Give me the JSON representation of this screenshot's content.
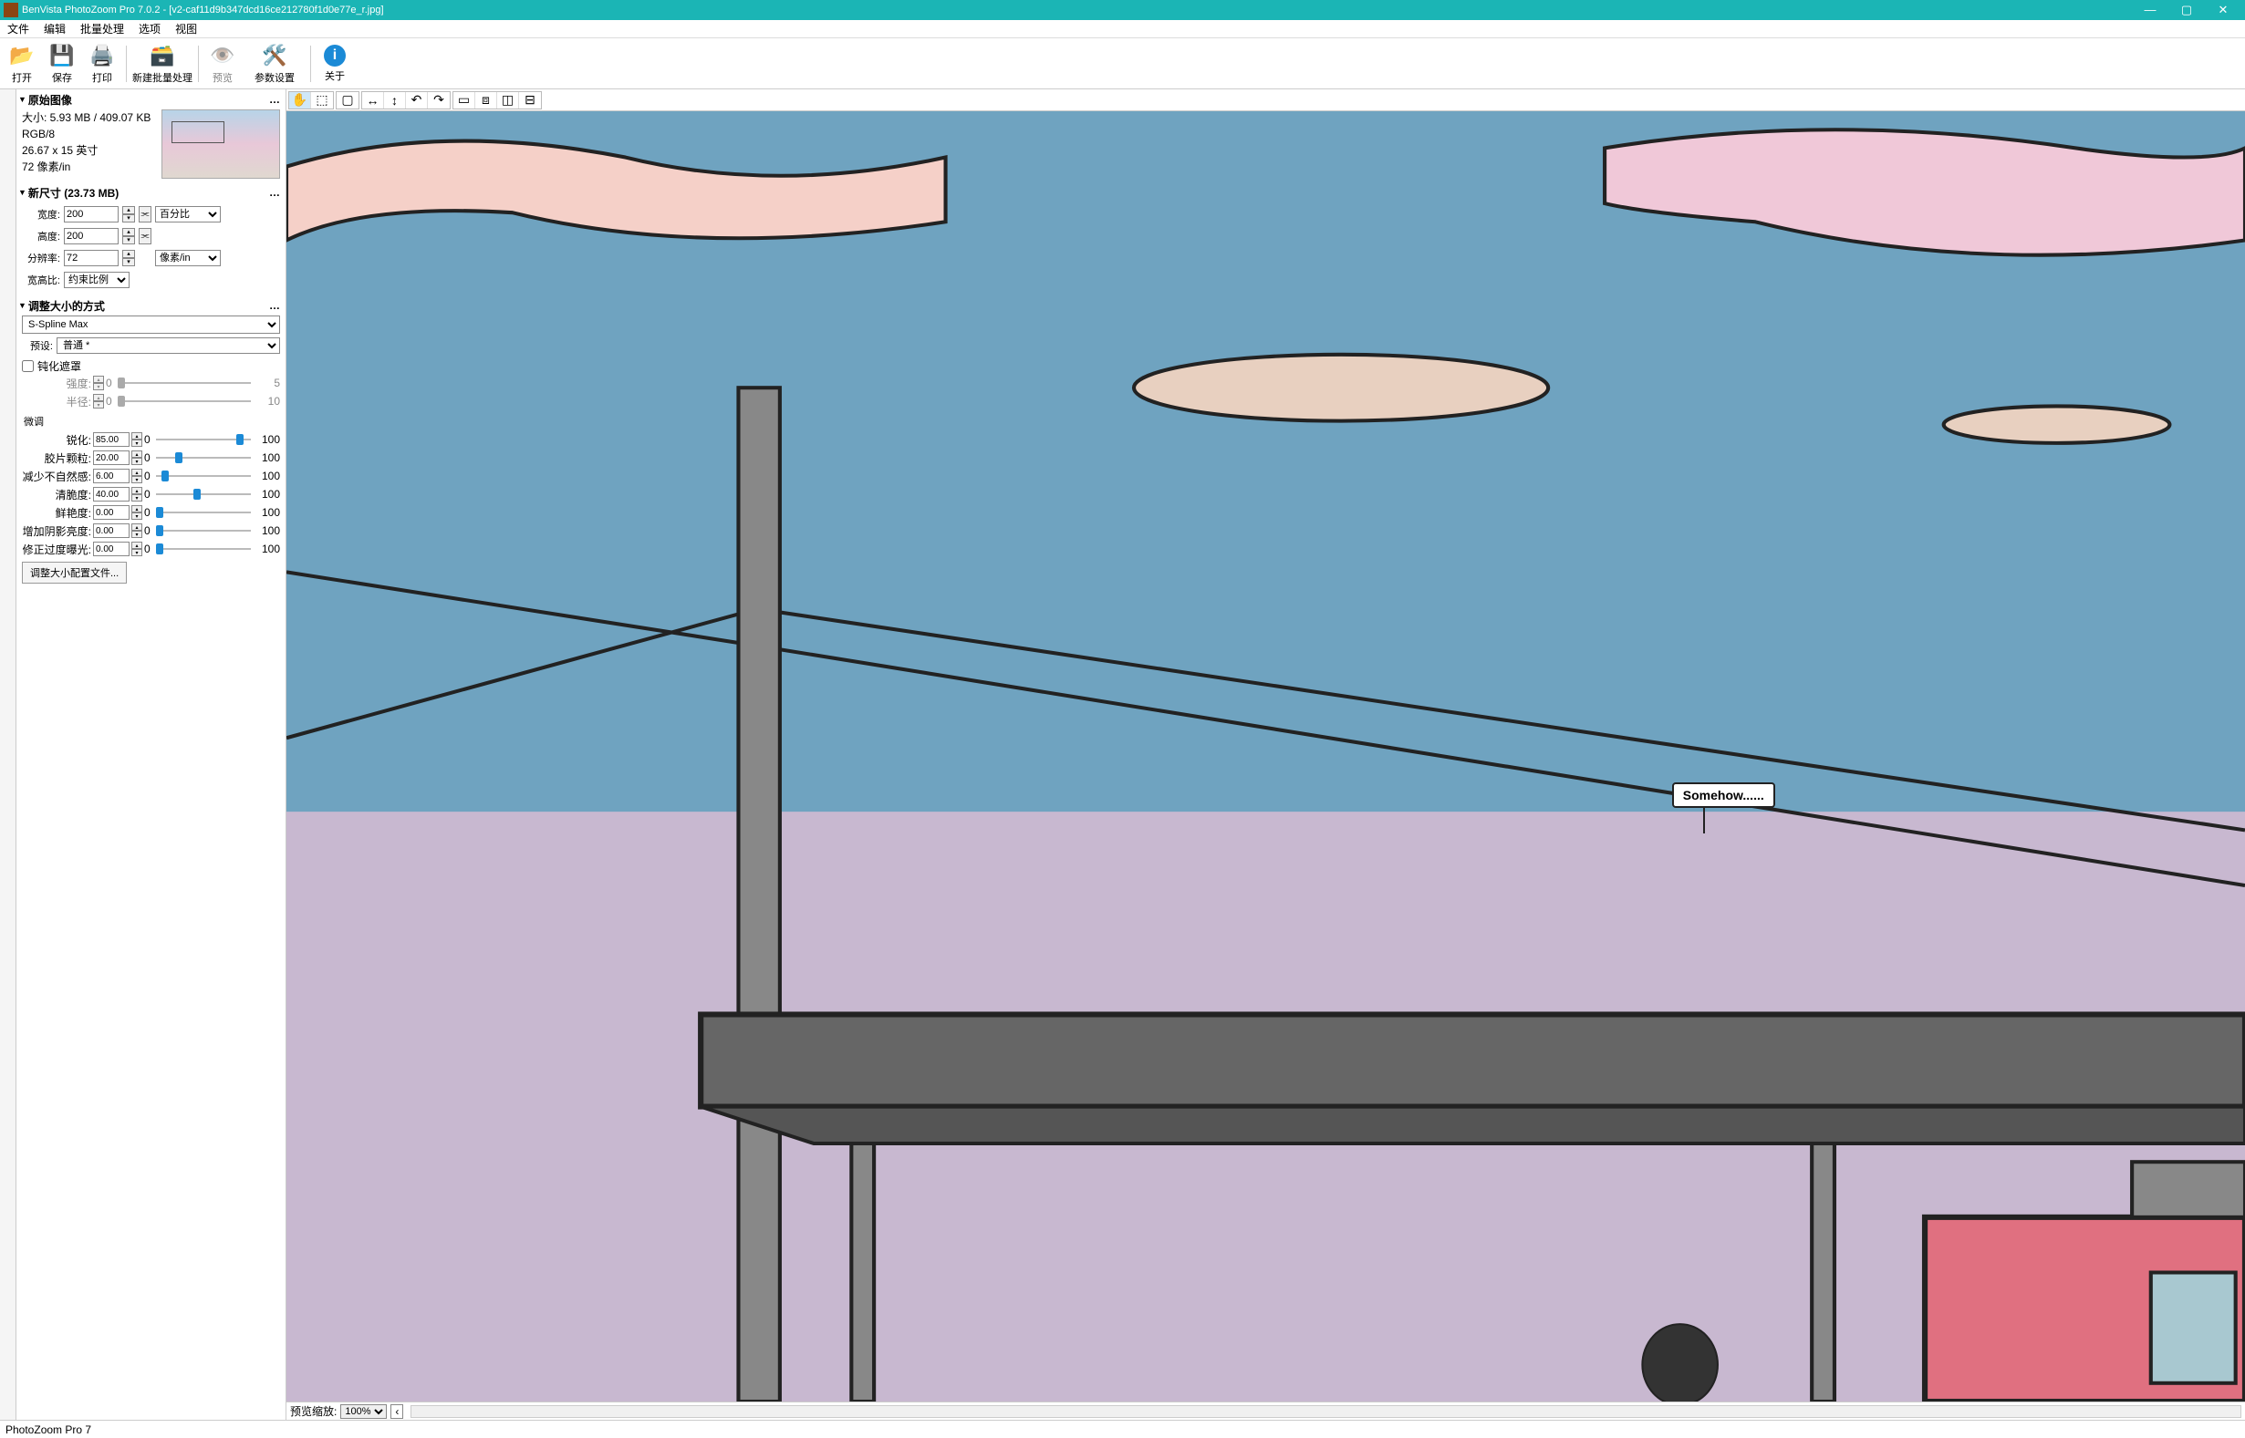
{
  "title": "BenVista PhotoZoom Pro 7.0.2 - [v2-caf11d9b347dcd16ce212780f1d0e77e_r.jpg]",
  "menu": {
    "file": "文件",
    "edit": "编辑",
    "batch": "批量处理",
    "options": "选项",
    "view": "视图"
  },
  "tb": {
    "open": "打开",
    "save": "保存",
    "print": "打印",
    "newbatch": "新建批量处理",
    "preview": "预览",
    "params": "参数设置",
    "about": "关于"
  },
  "sec": {
    "orig": "原始图像",
    "size": "大小: 5.93 MB / 409.07 KB",
    "mode": "RGB/8",
    "dim": "26.67 x 15 英寸",
    "res": "72 像素/in",
    "newsize_hdr": "新尺寸 (23.73 MB)",
    "width": "宽度:",
    "width_v": "200",
    "height": "高度:",
    "height_v": "200",
    "unit_pct": "百分比",
    "resol": "分辨率:",
    "resol_v": "72",
    "resol_unit": "像素/in",
    "aspect": "宽高比:",
    "aspect_v": "约束比例",
    "method_hdr": "调整大小的方式",
    "method": "S-Spline Max",
    "preset_lbl": "预设:",
    "preset": "普通 *",
    "unsharp": "钝化遮罩",
    "intensity": "强度:",
    "intensity_v": "0",
    "intensity_r": "5",
    "radius": "半径:",
    "radius_v": "0",
    "radius_r": "10",
    "finetune": "微调",
    "sharp": "锐化:",
    "sharp_v": "85.00",
    "grain": "胶片颗粒:",
    "grain_v": "20.00",
    "artifact": "减少不自然感:",
    "artifact_v": "6.00",
    "crisp": "清脆度:",
    "crisp_v": "40.00",
    "vivid": "鲜艳度:",
    "vivid_v": "0.00",
    "shadow": "增加阴影亮度:",
    "shadow_v": "0.00",
    "expo": "修正过度曝光:",
    "expo_v": "0.00",
    "r0": "0",
    "r100": "100",
    "cfg": "调整大小配置文件..."
  },
  "preview": {
    "label": "预览缩放:",
    "zoom": "100%"
  },
  "status": "PhotoZoom Pro 7",
  "bubble": "Somehow......"
}
